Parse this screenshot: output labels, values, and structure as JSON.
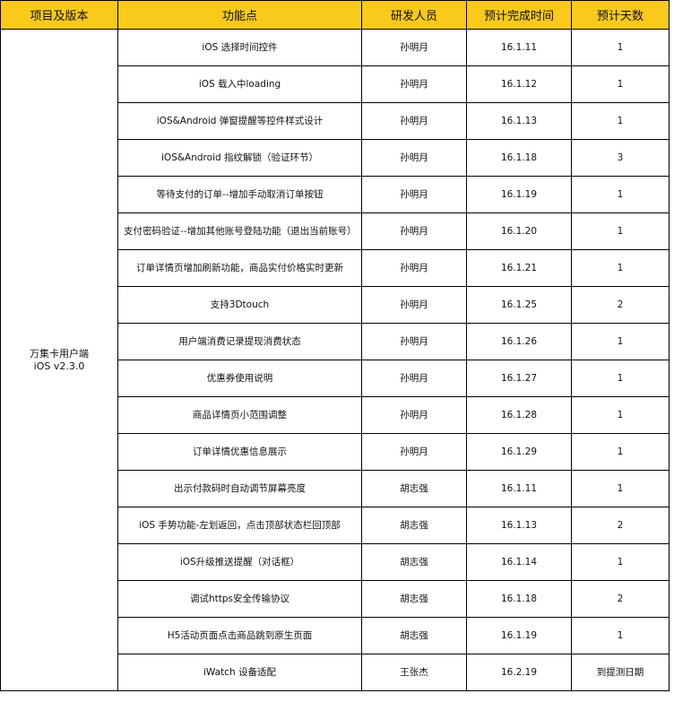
{
  "table": {
    "headers": [
      "项目及版本",
      "功能点",
      "研发人员",
      "预计完成时间",
      "预计天数"
    ],
    "project": {
      "name": "万集卡用户端",
      "version": "iOS v2.3.0"
    },
    "rows": [
      {
        "feature": "iOS 选择时间控件",
        "developer": "孙明月",
        "date": "16.1.11",
        "days": "1"
      },
      {
        "feature": "iOS 载入中loading",
        "developer": "孙明月",
        "date": "16.1.12",
        "days": "1"
      },
      {
        "feature": "iOS&Android 弹窗提醒等控件样式设计",
        "developer": "孙明月",
        "date": "16.1.13",
        "days": "1"
      },
      {
        "feature": "iOS&Android 指纹解锁（验证环节）",
        "developer": "孙明月",
        "date": "16.1.18",
        "days": "3"
      },
      {
        "feature": "等待支付的订单--增加手动取消订单按钮",
        "developer": "孙明月",
        "date": "16.1.19",
        "days": "1"
      },
      {
        "feature": "支付密码验证--增加其他账号登陆功能（退出当前账号）",
        "developer": "孙明月",
        "date": "16.1.20",
        "days": "1"
      },
      {
        "feature": "订单详情页增加刷新功能，商品实付价格实时更新",
        "developer": "孙明月",
        "date": "16.1.21",
        "days": "1"
      },
      {
        "feature": "支持3Dtouch",
        "developer": "孙明月",
        "date": "16.1.25",
        "days": "2"
      },
      {
        "feature": "用户端消费记录提现消费状态",
        "developer": "孙明月",
        "date": "16.1.26",
        "days": "1"
      },
      {
        "feature": "优惠券使用说明",
        "developer": "孙明月",
        "date": "16.1.27",
        "days": "1"
      },
      {
        "feature": "商品详情页小范围调整",
        "developer": "孙明月",
        "date": "16.1.28",
        "days": "1"
      },
      {
        "feature": "订单详情优惠信息展示",
        "developer": "孙明月",
        "date": "16.1.29",
        "days": "1"
      },
      {
        "feature": "出示付款码时自动调节屏幕亮度",
        "developer": "胡志强",
        "date": "16.1.11",
        "days": "1"
      },
      {
        "feature": "iOS 手势功能-左划返回，点击顶部状态栏回顶部",
        "developer": "胡志强",
        "date": "16.1.13",
        "days": "2"
      },
      {
        "feature": "iOS升级推送提醒（对话框）",
        "developer": "胡志强",
        "date": "16.1.14",
        "days": "1"
      },
      {
        "feature": "调试https安全传输协议",
        "developer": "胡志强",
        "date": "16.1.18",
        "days": "2"
      },
      {
        "feature": "H5活动页面点击商品跳到原生页面",
        "developer": "胡志强",
        "date": "16.1.19",
        "days": "1"
      },
      {
        "feature": "iWatch 设备适配",
        "developer": "王张杰",
        "date": "16.2.19",
        "days": "到提测日期"
      }
    ]
  },
  "colors": {
    "header_background": "#f9c91c",
    "border": "#000000"
  }
}
